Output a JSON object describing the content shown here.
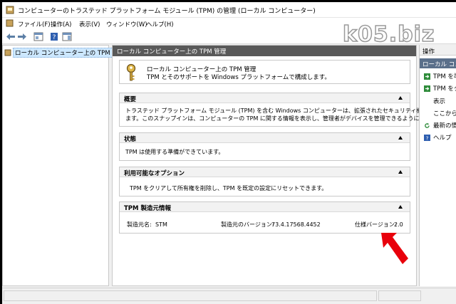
{
  "window": {
    "title": "コンピューターのトラステッド プラットフォーム モジュール (TPM) の管理 (ローカル コンピューター)"
  },
  "menu": {
    "items": [
      "ファイル(F)",
      "操作(A)",
      "表示(V)",
      "ウィンドウ(W)",
      "ヘルプ(H)"
    ]
  },
  "watermark": "k05.biz",
  "tree": {
    "node_label": "ローカル コンピューター上の TPM 管理"
  },
  "center": {
    "header": "ローカル コンピューター上の TPM 管理",
    "intro_title": "ローカル コンピューター上の TPM 管理",
    "intro_desc": "TPM とそのサポートを Windows プラットフォームで構成します。",
    "sections": {
      "overview": {
        "title": "概要",
        "line1": "トラステッド プラットフォーム モジュール (TPM) を含む Windows コンピューターは、拡張されたセキュリティ機能を提供し",
        "line2": "ます。このスナップインは、コンピューターの TPM に関する情報を表示し、管理者がデバイスを管理できるようにします。"
      },
      "status": {
        "title": "状態",
        "text": "TPM は使用する準備ができています。"
      },
      "options": {
        "title": "利用可能なオプション",
        "text": "TPM をクリアして所有権を削除し、TPM を既定の設定にリセットできます。"
      },
      "manufacturer": {
        "title": "TPM 製造元情報",
        "name_label": "製造元名:",
        "name_value": "STM",
        "version_label": "製造元のバージョン:",
        "version_value": "73.4.17568.4452",
        "spec_label": "仕様バージョン:",
        "spec_value": "2.0"
      }
    }
  },
  "actions": {
    "header": "操作",
    "selected": "ローカル コンピ",
    "items": [
      {
        "label": "TPM を準",
        "icon": "green-arrow-icon"
      },
      {
        "label": "TPM をク",
        "icon": "green-arrow-icon"
      },
      {
        "label": "表示",
        "icon": ""
      },
      {
        "label": "ここから新",
        "icon": ""
      },
      {
        "label": "最新の情報",
        "icon": "refresh-icon"
      },
      {
        "label": "ヘルプ",
        "icon": "help-icon"
      }
    ]
  },
  "colors": {
    "header_bg": "#595959",
    "action_selected": "#5a6f8a",
    "tree_selected": "#cde8ff",
    "annotation_arrow": "#e8000b"
  }
}
